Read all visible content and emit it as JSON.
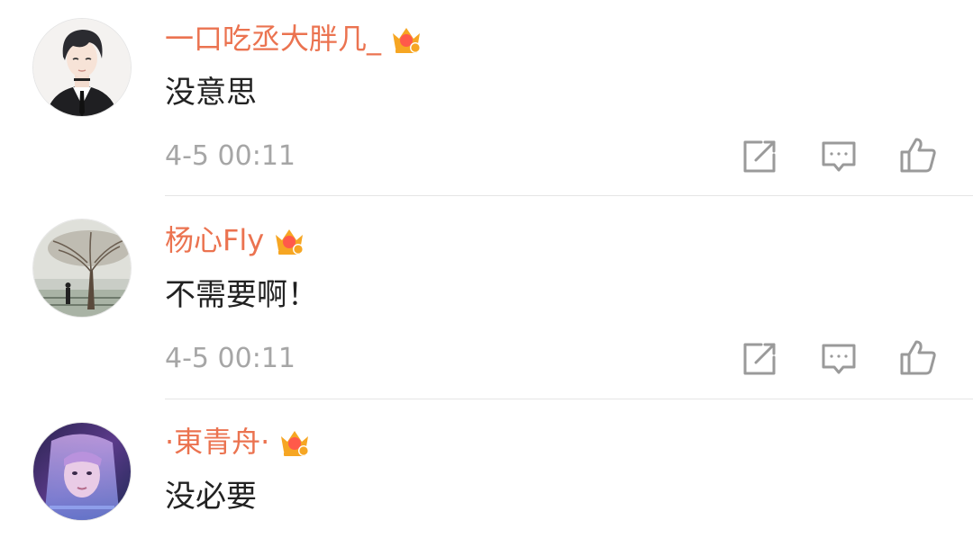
{
  "colors": {
    "username": "#eb7350",
    "comment_text": "#222222",
    "timestamp": "#a6a6a6",
    "icon": "#9a9a9a",
    "divider": "#e5e5e5",
    "vip_crown": "#f6a623"
  },
  "comments": [
    {
      "username": "一口吃丞大胖几_",
      "badge": "vip-crown-icon",
      "text": "没意思",
      "timestamp": "4-5 00:11",
      "actions": [
        "repost-icon",
        "reply-icon",
        "like-icon"
      ]
    },
    {
      "username": "杨心Fly",
      "badge": "vip-crown-icon",
      "text": "不需要啊！",
      "timestamp": "4-5 00:11",
      "actions": [
        "repost-icon",
        "reply-icon",
        "like-icon"
      ]
    },
    {
      "username": "·東青舟·",
      "badge": "vip-crown-icon",
      "text": "没必要"
    }
  ]
}
